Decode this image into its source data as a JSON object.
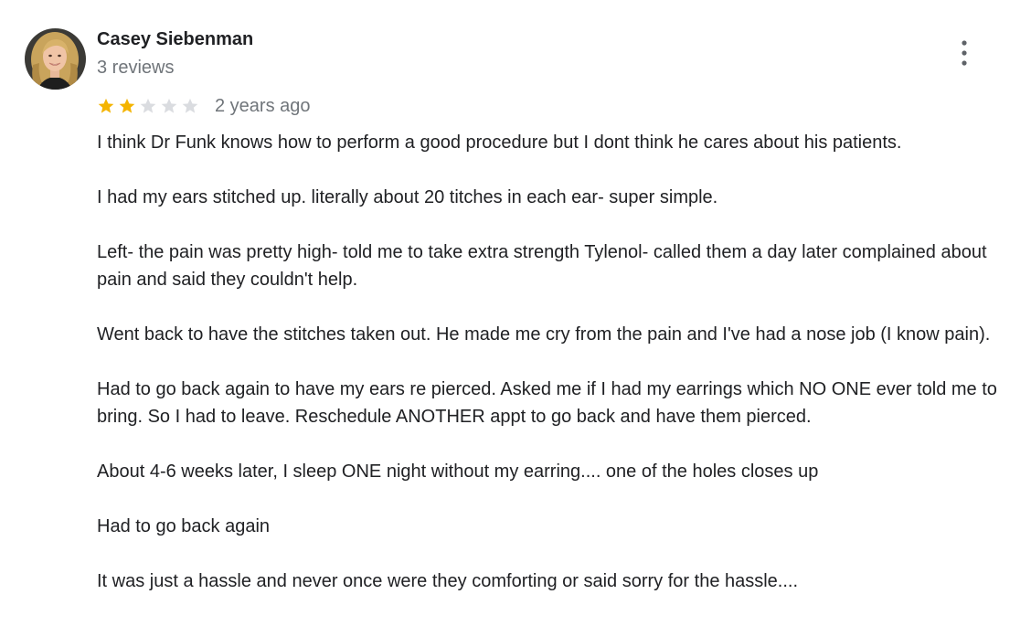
{
  "reviewer": {
    "name": "Casey Siebenman",
    "reviews_count": "3 reviews",
    "avatar_icon": "reviewer-avatar-photo"
  },
  "menu": {
    "icon": "more-vert-icon"
  },
  "rating": {
    "stars_filled": 2,
    "stars_total": 5,
    "filled_color": "#f4b400",
    "empty_color": "#dadce0",
    "date": "2 years ago"
  },
  "body": {
    "paragraphs": [
      "I think Dr Funk knows how to perform a good procedure but I dont think he cares about his patients.",
      "I had my ears stitched up. literally about 20 titches in each ear- super simple.",
      "Left- the pain was pretty high- told me to take extra strength Tylenol- called them a day later complained about pain and said they couldn't help.",
      "Went back to have the stitches taken out. He made me cry from the pain and I've had a nose job (I know pain).",
      "Had to go back again to have my ears re pierced. Asked me if I had my earrings which NO ONE ever told me to bring. So I had to leave. Reschedule ANOTHER appt to go back and have them pierced.",
      "About 4-6 weeks later, I sleep ONE night without my earring.... one of the holes closes up",
      "Had to go back again",
      "It was just a hassle and never once were they comforting or said sorry for the hassle...."
    ]
  },
  "colors": {
    "text_primary": "#202124",
    "text_secondary": "#70757a",
    "menu_dots": "#5f6368"
  }
}
